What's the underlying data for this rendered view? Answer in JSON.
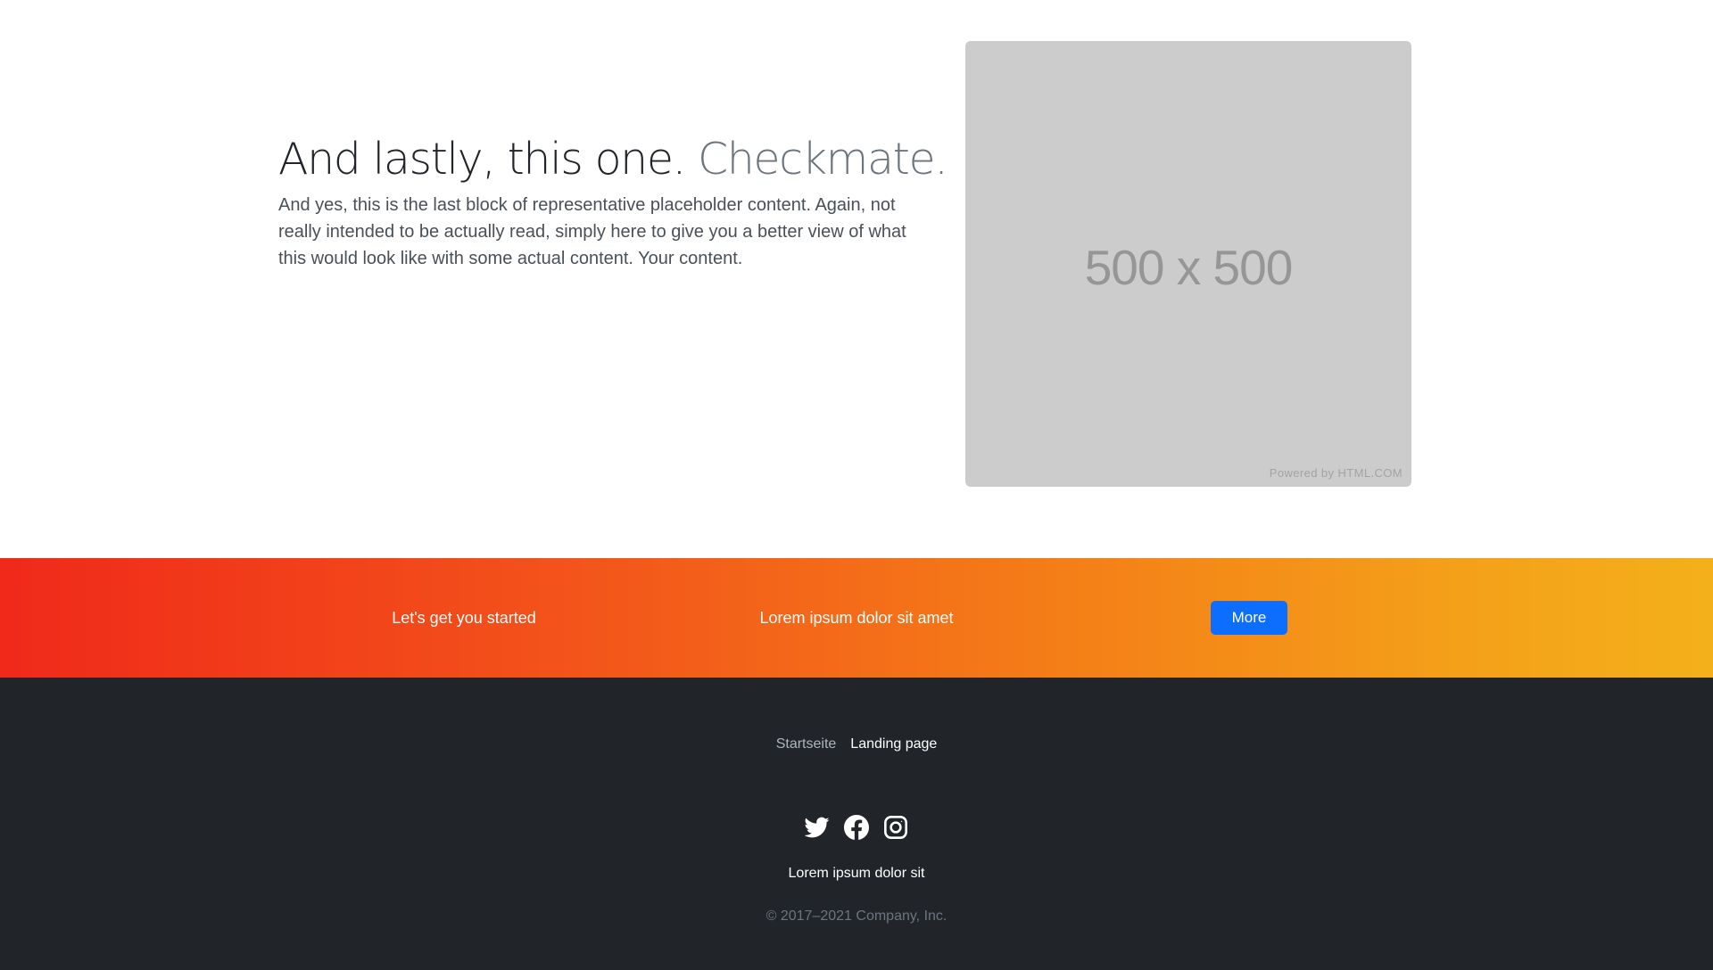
{
  "feature": {
    "heading_main": "And lastly, this one.",
    "heading_muted": "Checkmate.",
    "lead": "And yes, this is the last block of representative placeholder content. Again, not really intended to be actually read, simply here to give you a better view of what this would look like with some actual content. Your content.",
    "placeholder_label": "500 x 500",
    "placeholder_credit": "Powered by HTML.COM"
  },
  "cta": {
    "left_text": "Let's get you started",
    "middle_text": "Lorem ipsum dolor sit amet",
    "button_label": "More",
    "button_color": "#0d6efd",
    "gradient_start": "#f0291a",
    "gradient_end": "#f4b01a"
  },
  "footer": {
    "nav": [
      {
        "label": "Startseite"
      },
      {
        "label": "Landing page"
      }
    ],
    "social_icons": [
      "twitter-icon",
      "facebook-icon",
      "instagram-icon"
    ],
    "tagline": "Lorem ipsum dolor sit",
    "copyright": "© 2017–2021 Company, Inc."
  }
}
